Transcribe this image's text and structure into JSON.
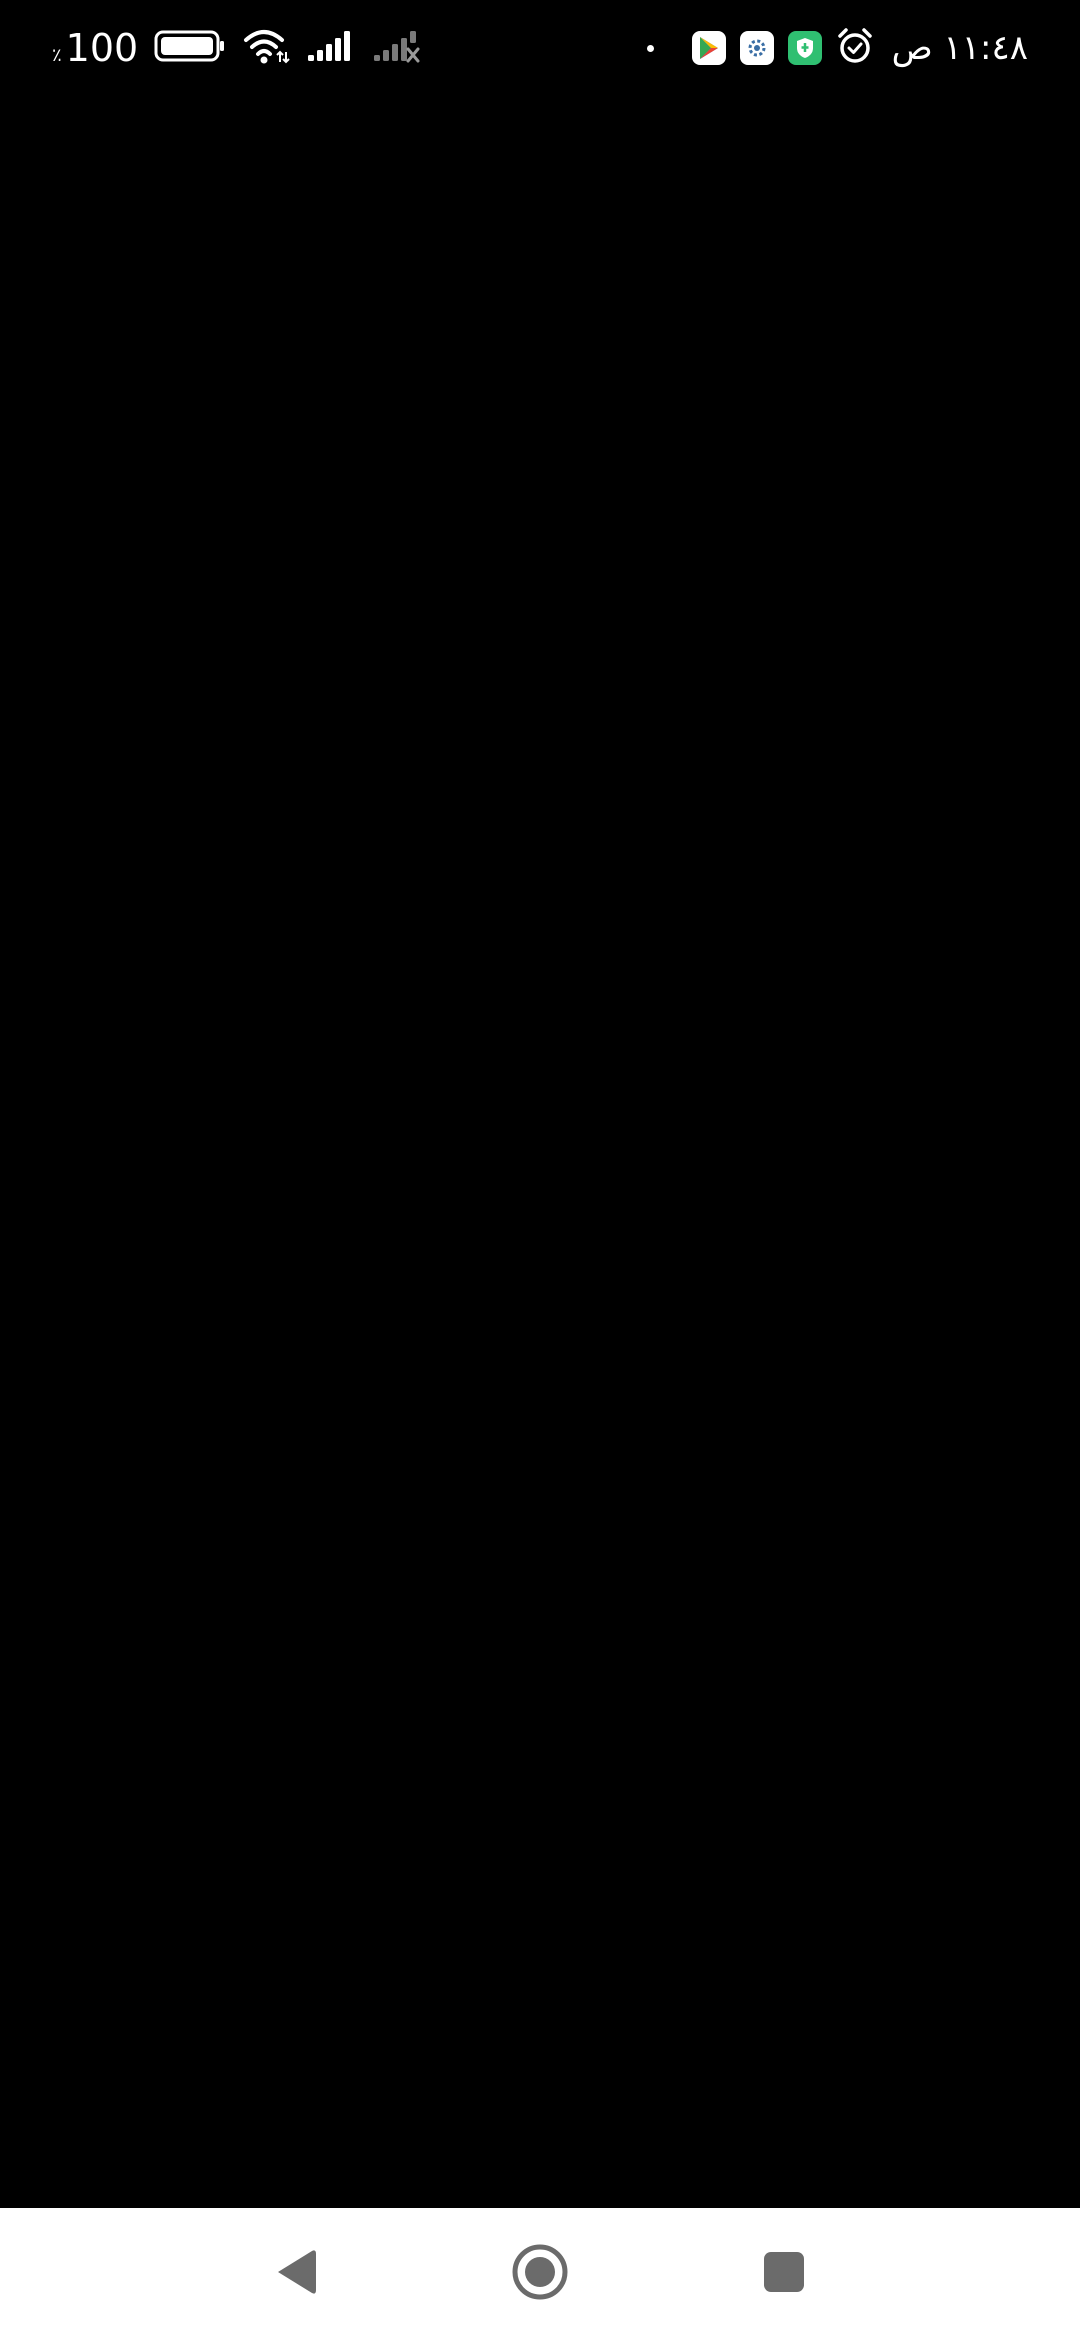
{
  "status_bar": {
    "battery_percent": "100",
    "battery_percent_sign": "٪",
    "time": "١١:٤٨ ص",
    "icons": {
      "battery": "battery-full-icon",
      "wifi": "wifi-icon",
      "signal_1": "cellular-signal-icon",
      "signal_2": "cellular-signal-no-service-icon",
      "notification_dot": "notification-dot-icon",
      "app_1": "google-play-icon",
      "app_2": "settings-gear-app-icon",
      "app_3": "shield-security-app-icon",
      "alarm": "alarm-clock-icon"
    }
  },
  "nav_bar": {
    "back": "back-triangle-icon",
    "home": "home-circle-icon",
    "recents": "recents-square-icon"
  },
  "colors": {
    "screen_background": "#000000",
    "nav_background": "#ffffff",
    "nav_icon": "#6b6b6b",
    "status_text": "#ffffff",
    "shield_app": "#2fbf71"
  }
}
